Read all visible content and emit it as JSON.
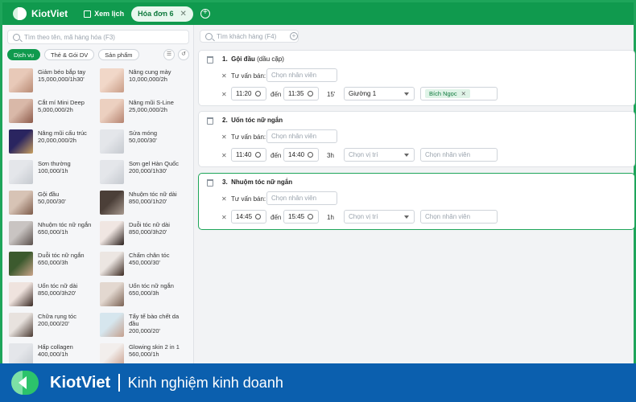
{
  "topbar": {
    "brand": "KiotViet",
    "schedule_link": "Xem lịch",
    "active_tab": "Hóa đơn 6",
    "close_icon": "close-icon",
    "add_icon": "plus-circle-icon"
  },
  "left": {
    "search_placeholder": "Tìm theo tên, mã hàng hóa (F3)",
    "filters": [
      "Dịch vụ",
      "Thẻ & Gói DV",
      "Sản phẩm"
    ],
    "products": [
      {
        "name": "Giảm béo bắp tay",
        "price": "15,000,000/1h30'"
      },
      {
        "name": "Nâng cung mày",
        "price": "10,000,000/2h"
      },
      {
        "name": "Cắt mí Mini Deep",
        "price": "5,000,000/2h"
      },
      {
        "name": "Nâng mũi S-Line",
        "price": "25,000,000/2h"
      },
      {
        "name": "Nâng mũi cấu trúc",
        "price": "20,000,000/2h"
      },
      {
        "name": "Sửa móng",
        "price": "50,000/30'"
      },
      {
        "name": "Sơn thường",
        "price": "100,000/1h"
      },
      {
        "name": "Sơn gel Hàn Quốc",
        "price": "200,000/1h30'"
      },
      {
        "name": "Gội đầu",
        "price": "50,000/30'"
      },
      {
        "name": "Nhuộm tóc nữ dài",
        "price": "850,000/1h20'"
      },
      {
        "name": "Nhuộm tóc nữ ngắn",
        "price": "650,000/1h"
      },
      {
        "name": "Duỗi tóc nữ dài",
        "price": "850,000/3h20'"
      },
      {
        "name": "Duỗi tóc nữ ngắn",
        "price": "650,000/3h"
      },
      {
        "name": "Chấm chân tóc",
        "price": "450,000/30'"
      },
      {
        "name": "Uốn tóc nữ dài",
        "price": "850,000/3h20'"
      },
      {
        "name": "Uốn tóc nữ ngắn",
        "price": "650,000/3h"
      },
      {
        "name": "Chữa rụng tóc",
        "price": "200,000/20'"
      },
      {
        "name": "Tẩy tế bào chết da đầu",
        "price": "200,000/20'"
      },
      {
        "name": "Hấp collagen",
        "price": "400,000/1h"
      },
      {
        "name": "Glowing skin 2 in 1",
        "price": "560,000/1h"
      }
    ]
  },
  "right": {
    "search_placeholder": "Tìm khách hàng (F4)",
    "labels": {
      "consultant": "Tư vấn bán:",
      "to": "đến",
      "staff_placeholder": "Chọn nhân viên",
      "position_placeholder": "Chọn vị trí"
    },
    "services": [
      {
        "index": "1.",
        "name": "Gội đầu",
        "variant": "(dầu cặp)",
        "start": "11:20",
        "end": "11:35",
        "duration": "15'",
        "position": "Giường 1",
        "staff_tag": "Bích Ngọc"
      },
      {
        "index": "2.",
        "name": "Uốn tóc nữ ngắn",
        "variant": "",
        "start": "11:40",
        "end": "14:40",
        "duration": "3h",
        "position": "Chọn vị trí",
        "staff_tag": ""
      },
      {
        "index": "3.",
        "name": "Nhuộm tóc nữ ngắn",
        "variant": "",
        "start": "14:45",
        "end": "15:45",
        "duration": "1h",
        "position": "Chọn vị trí",
        "staff_tag": ""
      }
    ]
  },
  "banner": {
    "brand": "KiotViet",
    "tagline": "Kinh nghiệm kinh doanh"
  },
  "colors": {
    "brand_green": "#109a4e",
    "banner_blue": "#0b5fae"
  }
}
